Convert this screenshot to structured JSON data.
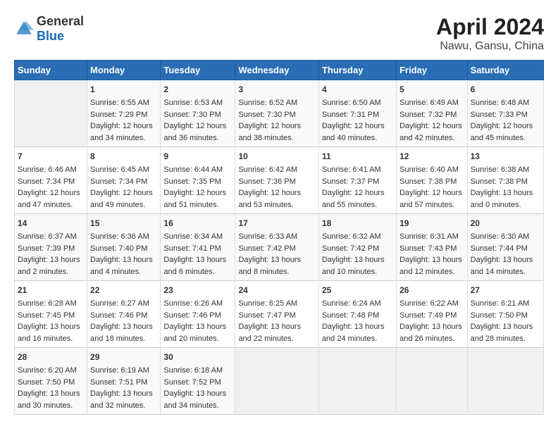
{
  "logo": {
    "general": "General",
    "blue": "Blue"
  },
  "title": "April 2024",
  "subtitle": "Nawu, Gansu, China",
  "headers": [
    "Sunday",
    "Monday",
    "Tuesday",
    "Wednesday",
    "Thursday",
    "Friday",
    "Saturday"
  ],
  "weeks": [
    [
      {
        "day": "",
        "empty": true
      },
      {
        "day": "1",
        "sunrise": "Sunrise: 6:55 AM",
        "sunset": "Sunset: 7:29 PM",
        "daylight": "Daylight: 12 hours and 34 minutes."
      },
      {
        "day": "2",
        "sunrise": "Sunrise: 6:53 AM",
        "sunset": "Sunset: 7:30 PM",
        "daylight": "Daylight: 12 hours and 36 minutes."
      },
      {
        "day": "3",
        "sunrise": "Sunrise: 6:52 AM",
        "sunset": "Sunset: 7:30 PM",
        "daylight": "Daylight: 12 hours and 38 minutes."
      },
      {
        "day": "4",
        "sunrise": "Sunrise: 6:50 AM",
        "sunset": "Sunset: 7:31 PM",
        "daylight": "Daylight: 12 hours and 40 minutes."
      },
      {
        "day": "5",
        "sunrise": "Sunrise: 6:49 AM",
        "sunset": "Sunset: 7:32 PM",
        "daylight": "Daylight: 12 hours and 42 minutes."
      },
      {
        "day": "6",
        "sunrise": "Sunrise: 6:48 AM",
        "sunset": "Sunset: 7:33 PM",
        "daylight": "Daylight: 12 hours and 45 minutes."
      }
    ],
    [
      {
        "day": "7",
        "sunrise": "Sunrise: 6:46 AM",
        "sunset": "Sunset: 7:34 PM",
        "daylight": "Daylight: 12 hours and 47 minutes."
      },
      {
        "day": "8",
        "sunrise": "Sunrise: 6:45 AM",
        "sunset": "Sunset: 7:34 PM",
        "daylight": "Daylight: 12 hours and 49 minutes."
      },
      {
        "day": "9",
        "sunrise": "Sunrise: 6:44 AM",
        "sunset": "Sunset: 7:35 PM",
        "daylight": "Daylight: 12 hours and 51 minutes."
      },
      {
        "day": "10",
        "sunrise": "Sunrise: 6:42 AM",
        "sunset": "Sunset: 7:36 PM",
        "daylight": "Daylight: 12 hours and 53 minutes."
      },
      {
        "day": "11",
        "sunrise": "Sunrise: 6:41 AM",
        "sunset": "Sunset: 7:37 PM",
        "daylight": "Daylight: 12 hours and 55 minutes."
      },
      {
        "day": "12",
        "sunrise": "Sunrise: 6:40 AM",
        "sunset": "Sunset: 7:38 PM",
        "daylight": "Daylight: 12 hours and 57 minutes."
      },
      {
        "day": "13",
        "sunrise": "Sunrise: 6:38 AM",
        "sunset": "Sunset: 7:38 PM",
        "daylight": "Daylight: 13 hours and 0 minutes."
      }
    ],
    [
      {
        "day": "14",
        "sunrise": "Sunrise: 6:37 AM",
        "sunset": "Sunset: 7:39 PM",
        "daylight": "Daylight: 13 hours and 2 minutes."
      },
      {
        "day": "15",
        "sunrise": "Sunrise: 6:36 AM",
        "sunset": "Sunset: 7:40 PM",
        "daylight": "Daylight: 13 hours and 4 minutes."
      },
      {
        "day": "16",
        "sunrise": "Sunrise: 6:34 AM",
        "sunset": "Sunset: 7:41 PM",
        "daylight": "Daylight: 13 hours and 6 minutes."
      },
      {
        "day": "17",
        "sunrise": "Sunrise: 6:33 AM",
        "sunset": "Sunset: 7:42 PM",
        "daylight": "Daylight: 13 hours and 8 minutes."
      },
      {
        "day": "18",
        "sunrise": "Sunrise: 6:32 AM",
        "sunset": "Sunset: 7:42 PM",
        "daylight": "Daylight: 13 hours and 10 minutes."
      },
      {
        "day": "19",
        "sunrise": "Sunrise: 6:31 AM",
        "sunset": "Sunset: 7:43 PM",
        "daylight": "Daylight: 13 hours and 12 minutes."
      },
      {
        "day": "20",
        "sunrise": "Sunrise: 6:30 AM",
        "sunset": "Sunset: 7:44 PM",
        "daylight": "Daylight: 13 hours and 14 minutes."
      }
    ],
    [
      {
        "day": "21",
        "sunrise": "Sunrise: 6:28 AM",
        "sunset": "Sunset: 7:45 PM",
        "daylight": "Daylight: 13 hours and 16 minutes."
      },
      {
        "day": "22",
        "sunrise": "Sunrise: 6:27 AM",
        "sunset": "Sunset: 7:46 PM",
        "daylight": "Daylight: 13 hours and 18 minutes."
      },
      {
        "day": "23",
        "sunrise": "Sunrise: 6:26 AM",
        "sunset": "Sunset: 7:46 PM",
        "daylight": "Daylight: 13 hours and 20 minutes."
      },
      {
        "day": "24",
        "sunrise": "Sunrise: 6:25 AM",
        "sunset": "Sunset: 7:47 PM",
        "daylight": "Daylight: 13 hours and 22 minutes."
      },
      {
        "day": "25",
        "sunrise": "Sunrise: 6:24 AM",
        "sunset": "Sunset: 7:48 PM",
        "daylight": "Daylight: 13 hours and 24 minutes."
      },
      {
        "day": "26",
        "sunrise": "Sunrise: 6:22 AM",
        "sunset": "Sunset: 7:49 PM",
        "daylight": "Daylight: 13 hours and 26 minutes."
      },
      {
        "day": "27",
        "sunrise": "Sunrise: 6:21 AM",
        "sunset": "Sunset: 7:50 PM",
        "daylight": "Daylight: 13 hours and 28 minutes."
      }
    ],
    [
      {
        "day": "28",
        "sunrise": "Sunrise: 6:20 AM",
        "sunset": "Sunset: 7:50 PM",
        "daylight": "Daylight: 13 hours and 30 minutes."
      },
      {
        "day": "29",
        "sunrise": "Sunrise: 6:19 AM",
        "sunset": "Sunset: 7:51 PM",
        "daylight": "Daylight: 13 hours and 32 minutes."
      },
      {
        "day": "30",
        "sunrise": "Sunrise: 6:18 AM",
        "sunset": "Sunset: 7:52 PM",
        "daylight": "Daylight: 13 hours and 34 minutes."
      },
      {
        "day": "",
        "empty": true
      },
      {
        "day": "",
        "empty": true
      },
      {
        "day": "",
        "empty": true
      },
      {
        "day": "",
        "empty": true
      }
    ]
  ]
}
